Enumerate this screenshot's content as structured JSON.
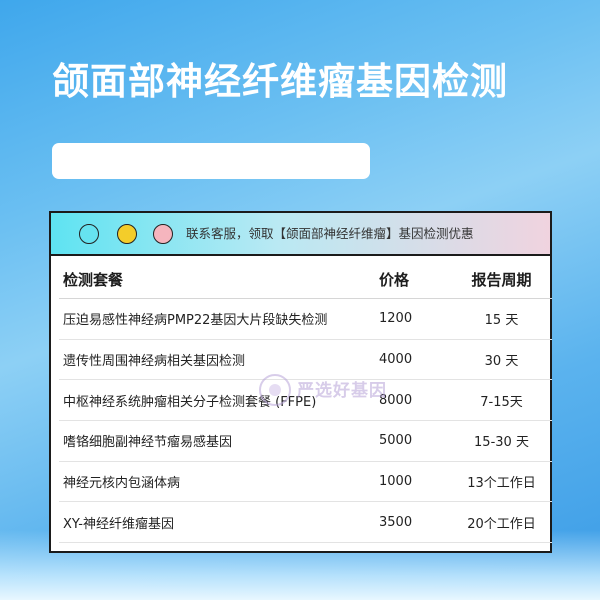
{
  "page": {
    "title": "颌面部神经纤维瘤基因检测"
  },
  "card": {
    "header_text": "联系客服，领取【颌面部神经纤维瘤】基因检测优惠",
    "dot_colors": [
      "#66e3f0",
      "#f4cd2a",
      "#f5b5be"
    ]
  },
  "table": {
    "columns": [
      "检测套餐",
      "价格",
      "报告周期"
    ],
    "rows": [
      [
        "压迫易感性神经病PMP22基因大片段缺失检测",
        "1200",
        "15 天"
      ],
      [
        "遗传性周围神经病相关基因检测",
        "4000",
        "30 天"
      ],
      [
        "中枢神经系统肿瘤相关分子检测套餐 (FFPE)",
        "8000",
        "7-15天"
      ],
      [
        "嗜铬细胞副神经节瘤易感基因",
        "5000",
        "15-30 天"
      ],
      [
        "神经元核内包涵体病",
        "1000",
        "13个工作日"
      ],
      [
        "XY-神经纤维瘤基因",
        "3500",
        "20个工作日"
      ]
    ]
  },
  "watermark": {
    "text": "严选好基因"
  }
}
